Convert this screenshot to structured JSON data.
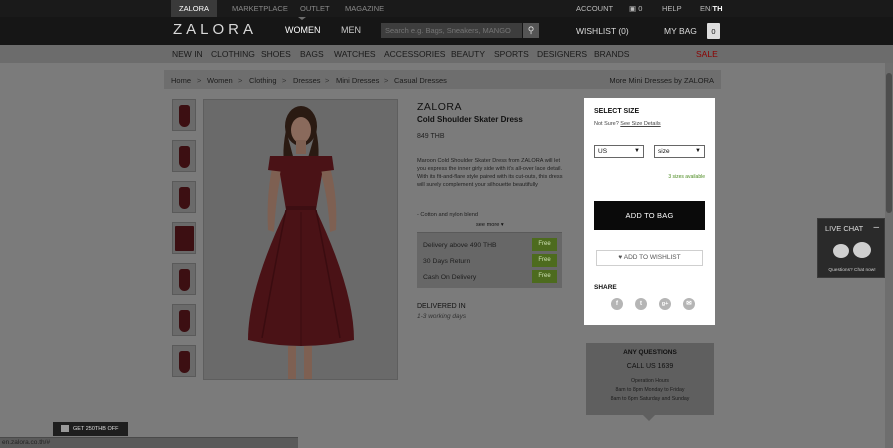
{
  "topbar": {
    "tabs": [
      "ZALORA",
      "MARKETPLACE",
      "OUTLET",
      "MAGAZINE"
    ],
    "account": "ACCOUNT",
    "cart_count": "0",
    "help": "HELP",
    "lang_en": "EN",
    "lang_sep": "/",
    "lang_th": "TH"
  },
  "header": {
    "logo": "ZALORA",
    "nav": [
      "WOMEN",
      "MEN"
    ],
    "search_placeholder": "Search e.g. Bags, Sneakers, MANGO",
    "wishlist": "WISHLIST (0)",
    "mybag": "MY BAG",
    "bag_count": "0"
  },
  "categories": [
    "NEW IN",
    "CLOTHING",
    "SHOES",
    "BAGS",
    "WATCHES",
    "ACCESSORIES",
    "BEAUTY",
    "SPORTS",
    "DESIGNERS",
    "BRANDS",
    "SALE"
  ],
  "breadcrumb": {
    "items": [
      "Home",
      "Women",
      "Clothing",
      "Dresses",
      "Mini Dresses",
      "Casual Dresses"
    ],
    "separator": ">",
    "more": "More Mini Dresses by ZALORA"
  },
  "product": {
    "brand": "ZALORA",
    "name": "Cold Shoulder Skater Dress",
    "price": "849 THB",
    "description": "Maroon Cold Shoulder Skater Dress from ZALORA will let you express the inner girly side with it's all-over lace detail. With its fit-and-flare style paired with its cut-outs, this dress will surely complement your silhouette beautifully",
    "bullet": "- Cotton and nylon blend",
    "see_more": "see more ▾",
    "perks": [
      {
        "label": "Delivery above 490 THB",
        "badge": "Free"
      },
      {
        "label": "30 Days Return",
        "badge": "Free"
      },
      {
        "label": "Cash On Delivery",
        "badge": "Free"
      }
    ],
    "delivered_in": "DELIVERED IN",
    "delivered_days": "1-3 working days",
    "dress_color": "#7a1e25"
  },
  "size_panel": {
    "title": "SELECT SIZE",
    "not_sure": "Not Sure?",
    "size_details": "See Size Details",
    "region_value": "US",
    "size_value": "size",
    "available": "3 sizes available",
    "add_to_bag": "ADD TO BAG",
    "add_to_wishlist": "♥ ADD TO WISHLIST",
    "share": "SHARE",
    "social": [
      "f",
      "t",
      "g+",
      "✉"
    ]
  },
  "questions": {
    "title": "ANY QUESTIONS",
    "call": "CALL US 1639",
    "hours_title": "Operation Hours",
    "hours_1": "8am to 8pm Monday to Friday",
    "hours_2": "8am to 6pm Saturday and Sunday"
  },
  "livechat": {
    "title": "LIVE CHAT",
    "minimize": "–",
    "subtitle": "Questions? Chat now!"
  },
  "promo": "GET 250THB OFF",
  "status_url": "en.zalora.co.th/#",
  "colors": {
    "header_bg": "#161616",
    "page_overlay": "#7b7b7b",
    "free_badge": "#4d6b1e",
    "sale": "#8b0000"
  }
}
